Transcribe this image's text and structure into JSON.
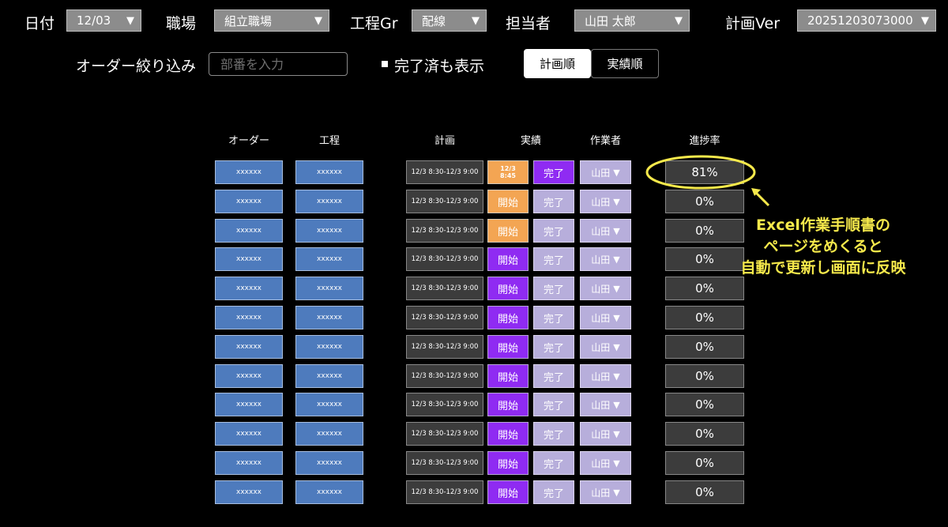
{
  "filters": {
    "date_label": "日付",
    "date_value": "12/03",
    "workplace_label": "職場",
    "workplace_value": "組立職場",
    "processgr_label": "工程Gr",
    "processgr_value": "配線",
    "assignee_label": "担当者",
    "assignee_value": "山田 太郎",
    "planver_label": "計画Ver",
    "planver_value": "20251203073000",
    "dropdown_arrow": "▼"
  },
  "order_filter": {
    "label": "オーダー絞り込み",
    "placeholder": "部番を入力",
    "value": ""
  },
  "show_completed": {
    "label": "完了済も表示",
    "checked": true
  },
  "sort": {
    "plan_order": "計画順",
    "actual_order": "実績順",
    "active": "計画順"
  },
  "columns": {
    "order": "オーダー",
    "process": "工程",
    "plan": "計画",
    "actual": "実績",
    "worker": "作業者",
    "progress": "進捗率"
  },
  "rows": [
    {
      "order": "xxxxxx",
      "process": "xxxxxx",
      "plan": "12/3 8:30-12/3 9:00",
      "actual_type": "time",
      "actual_line1": "12/3",
      "actual_line2": "8:45",
      "done": "完了",
      "done_style": "dark",
      "worker": "山田",
      "progress": "81%"
    },
    {
      "order": "xxxxxx",
      "process": "xxxxxx",
      "plan": "12/3 8:30-12/3 9:00",
      "actual_type": "orange",
      "actual": "開始",
      "done": "完了",
      "done_style": "light",
      "worker": "山田",
      "progress": "0%"
    },
    {
      "order": "xxxxxx",
      "process": "xxxxxx",
      "plan": "12/3 8:30-12/3 9:00",
      "actual_type": "orange",
      "actual": "開始",
      "done": "完了",
      "done_style": "light",
      "worker": "山田",
      "progress": "0%"
    },
    {
      "order": "xxxxxx",
      "process": "xxxxxx",
      "plan": "12/3 8:30-12/3 9:00",
      "actual_type": "purple",
      "actual": "開始",
      "done": "完了",
      "done_style": "light",
      "worker": "山田",
      "progress": "0%"
    },
    {
      "order": "xxxxxx",
      "process": "xxxxxx",
      "plan": "12/3 8:30-12/3 9:00",
      "actual_type": "purple",
      "actual": "開始",
      "done": "完了",
      "done_style": "light",
      "worker": "山田",
      "progress": "0%"
    },
    {
      "order": "xxxxxx",
      "process": "xxxxxx",
      "plan": "12/3 8:30-12/3 9:00",
      "actual_type": "purple",
      "actual": "開始",
      "done": "完了",
      "done_style": "light",
      "worker": "山田",
      "progress": "0%"
    },
    {
      "order": "xxxxxx",
      "process": "xxxxxx",
      "plan": "12/3 8:30-12/3 9:00",
      "actual_type": "purple",
      "actual": "開始",
      "done": "完了",
      "done_style": "light",
      "worker": "山田",
      "progress": "0%"
    },
    {
      "order": "xxxxxx",
      "process": "xxxxxx",
      "plan": "12/3 8:30-12/3 9:00",
      "actual_type": "purple",
      "actual": "開始",
      "done": "完了",
      "done_style": "light",
      "worker": "山田",
      "progress": "0%"
    },
    {
      "order": "xxxxxx",
      "process": "xxxxxx",
      "plan": "12/3 8:30-12/3 9:00",
      "actual_type": "purple",
      "actual": "開始",
      "done": "完了",
      "done_style": "light",
      "worker": "山田",
      "progress": "0%"
    },
    {
      "order": "xxxxxx",
      "process": "xxxxxx",
      "plan": "12/3 8:30-12/3 9:00",
      "actual_type": "purple",
      "actual": "開始",
      "done": "完了",
      "done_style": "light",
      "worker": "山田",
      "progress": "0%"
    },
    {
      "order": "xxxxxx",
      "process": "xxxxxx",
      "plan": "12/3 8:30-12/3 9:00",
      "actual_type": "purple",
      "actual": "開始",
      "done": "完了",
      "done_style": "light",
      "worker": "山田",
      "progress": "0%"
    },
    {
      "order": "xxxxxx",
      "process": "xxxxxx",
      "plan": "12/3 8:30-12/3 9:00",
      "actual_type": "purple",
      "actual": "開始",
      "done": "完了",
      "done_style": "light",
      "worker": "山田",
      "progress": "0%"
    }
  ],
  "annotation": {
    "lines": [
      "Excel作業手順書の",
      "ページをめくると",
      "自動で更新し画面に反映"
    ],
    "color": "#f6e94b"
  },
  "colors": {
    "order_cell": "#4e7bbd",
    "start_orange": "#f3a553",
    "start_purple": "#8f2bf2",
    "done_light": "#b7aedb",
    "plan_cell": "#3c3c3c"
  }
}
